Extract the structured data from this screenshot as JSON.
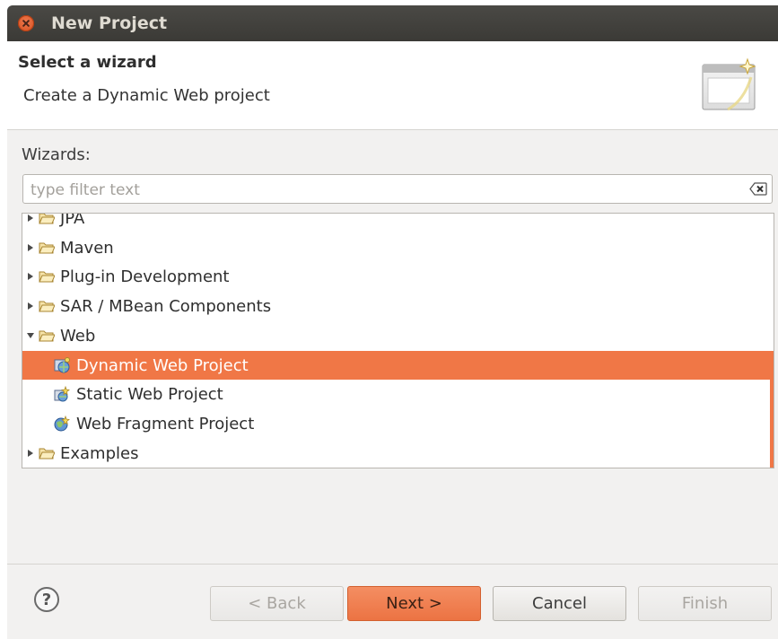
{
  "window": {
    "title": "New Project"
  },
  "header": {
    "title": "Select a wizard",
    "description": "Create a Dynamic Web project"
  },
  "wizards_label": "Wizards:",
  "filter": {
    "placeholder": "type filter text",
    "value": ""
  },
  "tree": [
    {
      "label": "JPA",
      "type": "folder",
      "expanded": false
    },
    {
      "label": "Maven",
      "type": "folder",
      "expanded": false
    },
    {
      "label": "Plug-in Development",
      "type": "folder",
      "expanded": false
    },
    {
      "label": "SAR / MBean Components",
      "type": "folder",
      "expanded": false
    },
    {
      "label": "Web",
      "type": "folder",
      "expanded": true
    },
    {
      "label": "Dynamic Web Project",
      "type": "item",
      "icon": "dynamic-web-project-icon",
      "selected": true
    },
    {
      "label": "Static Web Project",
      "type": "item",
      "icon": "static-web-project-icon",
      "selected": false
    },
    {
      "label": "Web Fragment Project",
      "type": "item",
      "icon": "web-fragment-project-icon",
      "selected": false
    },
    {
      "label": "Examples",
      "type": "folder",
      "expanded": false
    }
  ],
  "buttons": {
    "help": "?",
    "back": "< Back",
    "next": "Next >",
    "cancel": "Cancel",
    "finish": "Finish"
  },
  "colors": {
    "selection": "#f07746",
    "titlebar": "#3c3b37",
    "primary_button": "#f07746"
  }
}
